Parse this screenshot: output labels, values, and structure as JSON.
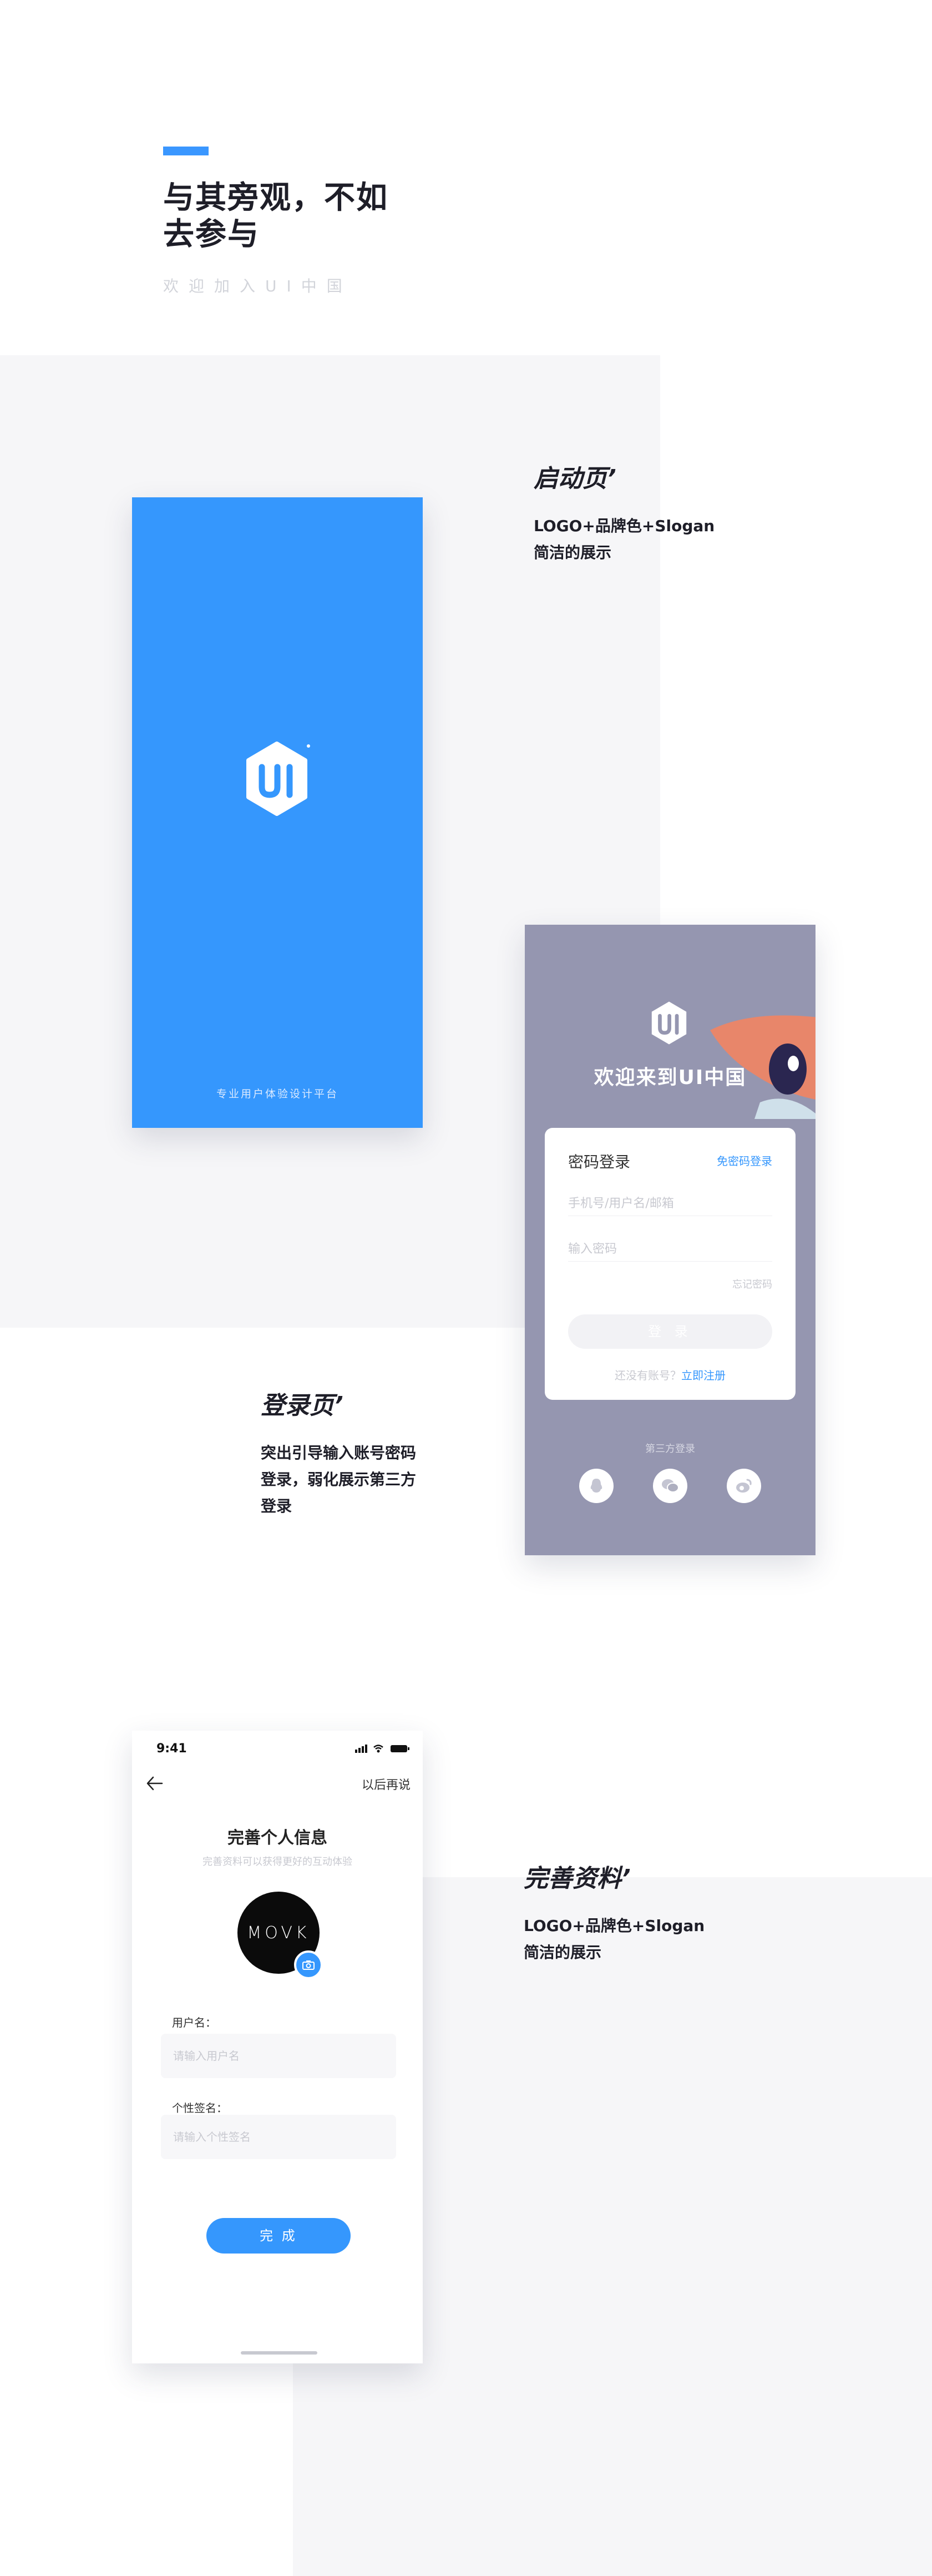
{
  "hero": {
    "title_line1": "与其旁观，不如",
    "title_line2": "去参与",
    "subtitle": "欢迎加入UI中国"
  },
  "sections": {
    "splash": {
      "title": "启动页’",
      "desc_line1": "LOGO+品牌色+Slogan",
      "desc_line2": "简洁的展示"
    },
    "login": {
      "title": "登录页’",
      "desc_line1": "突出引导输入账号密码",
      "desc_line2": "登录，弱化展示第三方",
      "desc_line3": "登录"
    },
    "profile": {
      "title": "完善资料’",
      "desc_line1": "LOGO+品牌色+Slogan",
      "desc_line2": "简洁的展示"
    }
  },
  "splash_screen": {
    "logo_text": "UI",
    "slogan": "专业用户体验设计平台"
  },
  "login_screen": {
    "logo_text": "UI",
    "welcome": "欢迎来到UI中国",
    "card_title": "密码登录",
    "alt_login": "免密码登录",
    "account_placeholder": "手机号/用户名/邮箱",
    "password_placeholder": "输入密码",
    "forgot": "忘记密码",
    "login_button": "登 录",
    "register_prompt": "还没有账号？",
    "register_link": "立即注册",
    "third_party_label": "第三方登录",
    "third_party": [
      "qq-icon",
      "wechat-icon",
      "weibo-icon"
    ]
  },
  "profile_screen": {
    "time": "9:41",
    "skip": "以后再说",
    "title": "完善个人信息",
    "subtitle": "完善资料可以获得更好的互动体验",
    "avatar_text": "MOVK",
    "username_label": "用户名：",
    "username_placeholder": "请输入用户名",
    "signature_label": "个性签名：",
    "signature_placeholder": "请输入个性签名",
    "done_button": "完 成"
  },
  "colors": {
    "accent": "#3597fd",
    "login_bg": "#9596b0",
    "page_gray": "#f6f6f8"
  }
}
